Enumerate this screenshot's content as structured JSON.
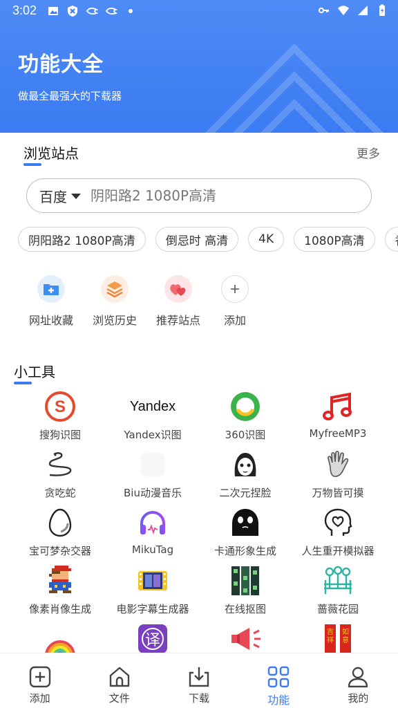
{
  "status_bar": {
    "time": "3:02",
    "left_icons": [
      "image-icon",
      "shield-icon",
      "bird-icon",
      "bird-icon",
      "dot-icon"
    ],
    "right_icons": [
      "key-icon",
      "wifi-icon",
      "signal-icon",
      "battery-icon"
    ]
  },
  "header": {
    "title": "功能大全",
    "subtitle": "做最全最强大的下载器",
    "bg_color": "#3a7bf2"
  },
  "browse": {
    "title": "浏览站点",
    "more_label": "更多",
    "search": {
      "engine": "百度",
      "placeholder": "阴阳路2 1080P高清"
    },
    "chips": [
      "阴阳路2 1080P高清",
      "倒忌时 高清",
      "4K",
      "1080P高清",
      "香"
    ],
    "quick_items": [
      {
        "label": "网址收藏",
        "icon": "folder-plus-icon"
      },
      {
        "label": "浏览历史",
        "icon": "layers-icon"
      },
      {
        "label": "推荐站点",
        "icon": "hearts-icon"
      },
      {
        "label": "添加",
        "icon": "plus-icon"
      }
    ]
  },
  "tools": {
    "title": "小工具",
    "items": [
      {
        "label": "搜狗识图",
        "icon": "sogou-icon"
      },
      {
        "label": "Yandex识图",
        "icon": "yandex-logo-icon",
        "logo_text": "Yandex"
      },
      {
        "label": "360识图",
        "icon": "360-icon"
      },
      {
        "label": "MyfreeMP3",
        "icon": "music-note-icon"
      },
      {
        "label": "贪吃蛇",
        "icon": "snake-icon"
      },
      {
        "label": "Biu动漫音乐",
        "icon": "anime-music-icon"
      },
      {
        "label": "二次元捏脸",
        "icon": "anime-face-icon"
      },
      {
        "label": "万物皆可摸",
        "icon": "hand-icon"
      },
      {
        "label": "宝可梦杂交器",
        "icon": "egg-icon"
      },
      {
        "label": "MikuTag",
        "icon": "headphones-icon"
      },
      {
        "label": "卡通形象生成",
        "icon": "ghost-icon"
      },
      {
        "label": "人生重开模拟器",
        "icon": "heart-head-icon"
      },
      {
        "label": "像素肖像生成",
        "icon": "pixel-mario-icon"
      },
      {
        "label": "电影字幕生成器",
        "icon": "film-icon"
      },
      {
        "label": "在线抠图",
        "icon": "film-strip-icon"
      },
      {
        "label": "蔷薇花园",
        "icon": "garden-icon"
      },
      {
        "label": "",
        "icon": "rainbow-icon"
      },
      {
        "label": "",
        "icon": "translate-icon",
        "logo_text": "译"
      },
      {
        "label": "",
        "icon": "megaphone-icon"
      },
      {
        "label": "",
        "icon": "couplet-icon",
        "logo_text": "吉祥 如意"
      }
    ]
  },
  "bottom_nav": {
    "items": [
      {
        "label": "添加",
        "icon": "add-square-icon"
      },
      {
        "label": "文件",
        "icon": "home-icon"
      },
      {
        "label": "下载",
        "icon": "download-icon"
      },
      {
        "label": "功能",
        "icon": "grid-icon",
        "active": true
      },
      {
        "label": "我的",
        "icon": "user-icon"
      }
    ],
    "active_color": "#3a7bf2"
  }
}
